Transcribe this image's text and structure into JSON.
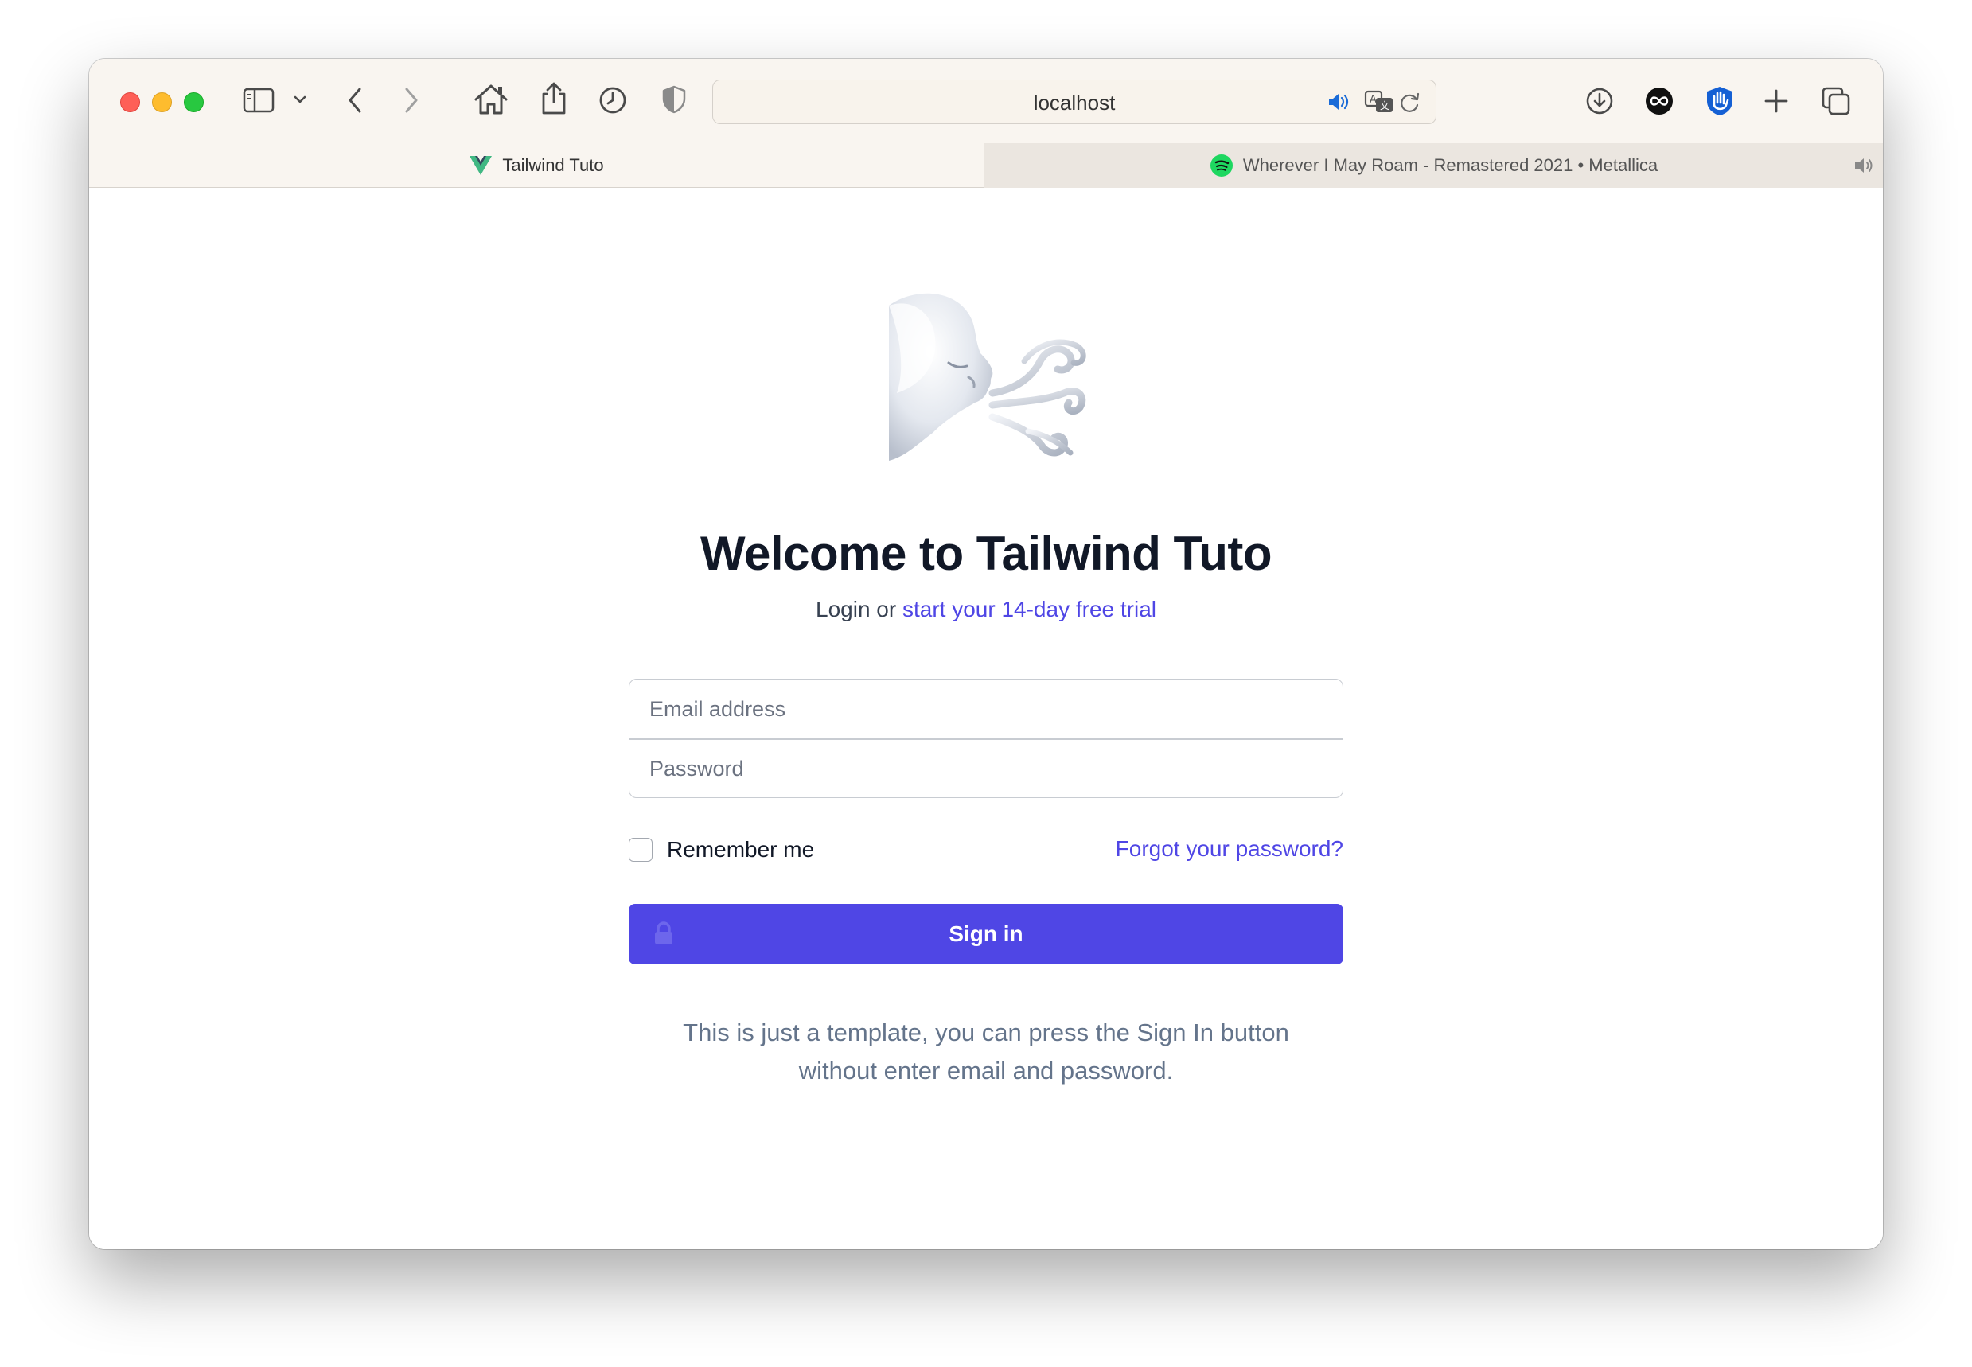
{
  "browser": {
    "address": "localhost",
    "tabs": [
      {
        "title": "Tailwind Tuto",
        "active": true,
        "favicon": "vue-icon"
      },
      {
        "title": "Wherever I May Roam - Remastered 2021 • Metallica",
        "active": false,
        "favicon": "spotify-icon",
        "audio": true
      }
    ],
    "icons": [
      "sidebar-icon",
      "chevron-down-icon",
      "back-icon",
      "forward-icon",
      "home-icon",
      "share-icon",
      "history-icon",
      "shield-icon",
      "audio-icon",
      "translate-icon",
      "reload-icon",
      "download-icon",
      "infinity-icon",
      "hand-icon",
      "new-tab-icon",
      "tabs-overview-icon"
    ]
  },
  "page": {
    "logo": "wind-face-icon",
    "title": "Welcome to Tailwind Tuto",
    "subtitle_prefix": "Login or ",
    "subtitle_link": "start your 14-day free trial",
    "email_placeholder": "Email address",
    "password_placeholder": "Password",
    "remember_label": "Remember me",
    "forgot_link": "Forgot your password?",
    "signin_label": "Sign in",
    "footnote_line1": "This is just a template, you can press the Sign In button",
    "footnote_line2": "without enter email and password."
  },
  "colors": {
    "accent": "#4f46e5",
    "title": "#111827",
    "muted": "#64748b",
    "toolbar": "#f9f5f0"
  }
}
